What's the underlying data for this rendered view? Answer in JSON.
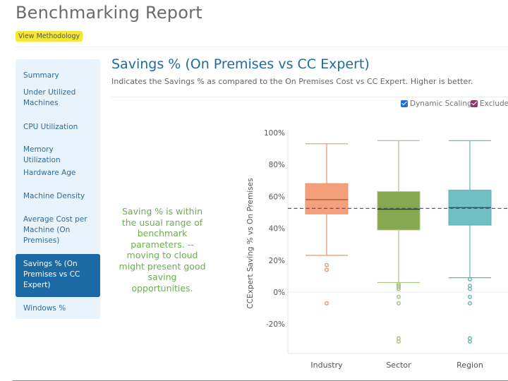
{
  "header": {
    "title": "Benchmarking Report",
    "methodology_label": "View Methodology"
  },
  "sidebar": {
    "items": [
      {
        "label": "Summary",
        "active": false
      },
      {
        "label": "Under Utilized Machines",
        "active": false
      },
      {
        "label": "CPU Utilization",
        "active": false
      },
      {
        "label": "Memory Utilization",
        "active": false
      },
      {
        "label": "Hardware Age",
        "active": false
      },
      {
        "label": "Machine Density",
        "active": false
      },
      {
        "label": "Average Cost per Machine (On Premises)",
        "active": false
      },
      {
        "label": "Savings % (On Premises vs CC Expert)",
        "active": true
      },
      {
        "label": "Windows %",
        "active": false
      }
    ]
  },
  "section": {
    "title": "Savings % (On Premises vs CC Expert)",
    "description": "Indicates the Savings % as compared to the On Premises Cost vs CC Expert. Higher is better."
  },
  "options": {
    "dynamic_scaling": {
      "label": "Dynamic Scaling",
      "checked": true,
      "color": "#1e6fd9"
    },
    "exclude": {
      "label": "Exclude",
      "checked": true,
      "color": "#8e3a6e"
    }
  },
  "insight": "Saving % is within the usual range of benchmark parameters. -- moving to cloud might present good saving opportunities.",
  "chart_data": {
    "type": "box",
    "title": "",
    "xlabel": "",
    "ylabel": "CCExpert Saving % vs On Premises",
    "ylim": [
      -40,
      100
    ],
    "yticks": [
      100,
      80,
      60,
      40,
      20,
      0,
      -20
    ],
    "ytick_labels": [
      "100%",
      "80%",
      "60%",
      "40%",
      "20%",
      "0%",
      "-20%"
    ],
    "categories": [
      "Industry",
      "Sector",
      "Region"
    ],
    "reference_line": {
      "value": 52.5,
      "style": "dashed",
      "color": "#4b4bd1"
    },
    "series": [
      {
        "name": "Industry",
        "color": "#f4a07a",
        "stroke": "#e8956f",
        "median_color": "#8a4a30",
        "whisker_low": 23,
        "q1": 49,
        "median": 58,
        "q3": 68,
        "whisker_high": 93,
        "outliers": [
          17,
          14,
          -7
        ]
      },
      {
        "name": "Sector",
        "color": "#86a84e",
        "stroke": "#a8bf82",
        "median_color": "#2e3a20",
        "whisker_low": 6,
        "q1": 39,
        "median": 52,
        "q3": 63,
        "whisker_high": 95,
        "outliers": [
          5,
          4,
          3,
          2,
          -3,
          -7,
          -29,
          -31
        ]
      },
      {
        "name": "Region",
        "color": "#6fbfc4",
        "stroke": "#5fb3b8",
        "median_color": "#1f4f52",
        "whisker_low": 9,
        "q1": 42,
        "median": 53,
        "q3": 64,
        "whisker_high": 95,
        "outliers": [
          8,
          4,
          2,
          -3,
          -7,
          -29,
          -31
        ]
      }
    ]
  }
}
